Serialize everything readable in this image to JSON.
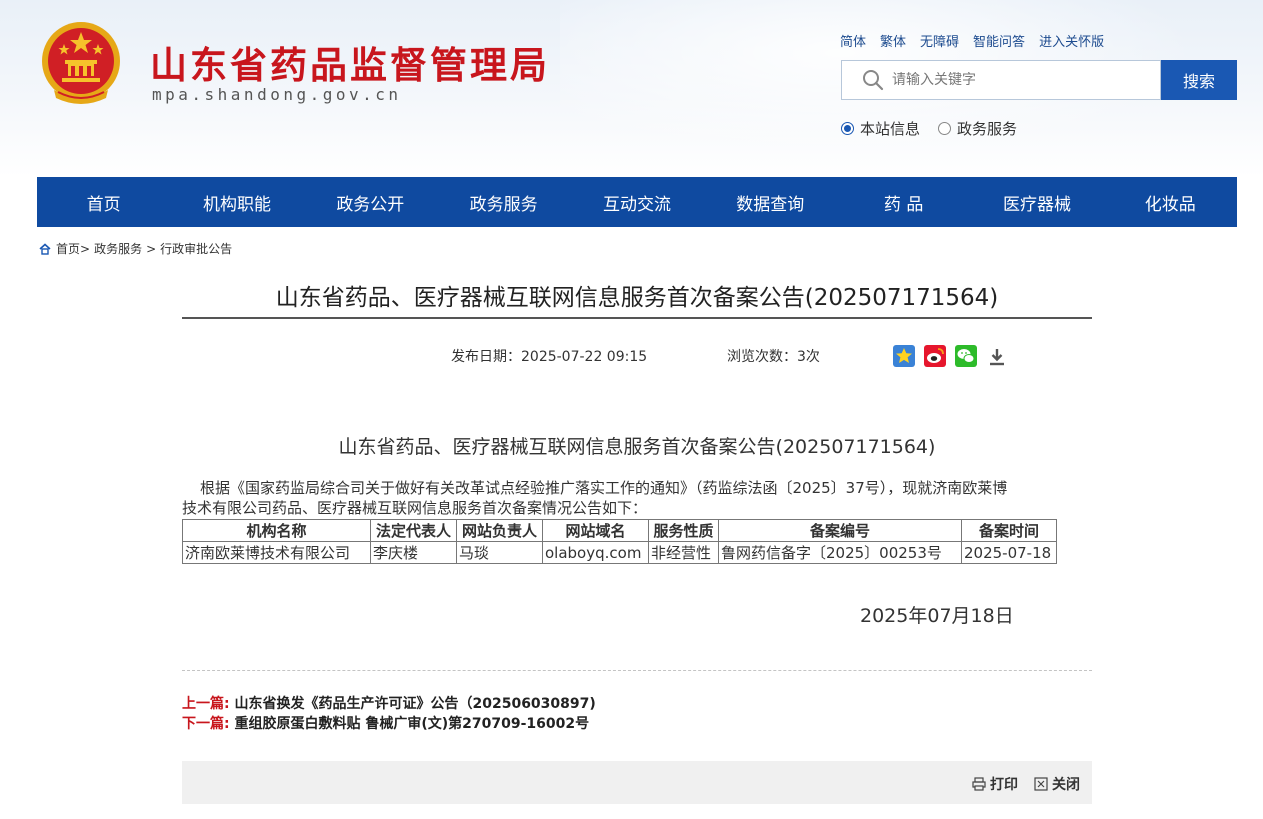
{
  "header": {
    "site_title": "山东省药品监督管理局",
    "site_domain": "mpa.shandong.gov.cn",
    "top_links": [
      "简体",
      "繁体",
      "无障碍",
      "智能问答",
      "进入关怀版"
    ],
    "search": {
      "placeholder": "请输入关键字",
      "button_label": "搜索",
      "scope_options": [
        {
          "label": "本站信息",
          "selected": true
        },
        {
          "label": "政务服务",
          "selected": false
        }
      ]
    }
  },
  "nav": {
    "items": [
      "首页",
      "机构职能",
      "政务公开",
      "政务服务",
      "互动交流",
      "数据查询",
      "药 品",
      "医疗器械",
      "化妆品"
    ]
  },
  "breadcrumb": {
    "items": [
      "首页>",
      "政务服务",
      ">",
      "行政审批公告"
    ]
  },
  "article": {
    "title": "山东省药品、医疗器械互联网信息服务首次备案公告(202507171564)",
    "publish_date": "发布日期：2025-07-22 09:15",
    "views": "浏览次数：3次",
    "subtitle": "山东省药品、医疗器械互联网信息服务首次备案公告(202507171564)",
    "paragraph_line1": "根据《国家药监局综合司关于做好有关改革试点经验推广落实工作的通知》（药监综法函〔2025〕37号），现就济南欧莱博",
    "paragraph_line2": "技术有限公司药品、医疗器械互联网信息服务首次备案情况公告如下：",
    "table": {
      "headers": [
        "机构名称",
        "法定代表人",
        "网站负责人",
        "网站域名",
        "服务性质",
        "备案编号",
        "备案时间"
      ],
      "rows": [
        [
          "济南欧莱博技术有限公司",
          "李庆楼",
          "马琰",
          "olaboyq.com",
          "非经营性",
          "鲁网药信备字〔2025〕00253号",
          "2025-07-18"
        ]
      ]
    },
    "closing_date": "2025年07月18日"
  },
  "prev_next": {
    "prev_label": "上一篇:",
    "prev_title": "山东省换发《药品生产许可证》公告（202506030897)",
    "next_label": "下一篇:",
    "next_title": "重组胶原蛋白敷料贴 鲁械广审(文)第270709-16002号"
  },
  "footer_tools": {
    "print": "打印",
    "close": "关闭"
  },
  "colors": {
    "brand_red": "#c8161d",
    "nav_blue": "#0f4aa0",
    "search_blue": "#1a58b3"
  },
  "icons": [
    "national-emblem",
    "search-icon",
    "home-icon",
    "favorite-icon",
    "weibo-icon",
    "wechat-icon",
    "download-icon",
    "print-icon",
    "close-icon"
  ]
}
